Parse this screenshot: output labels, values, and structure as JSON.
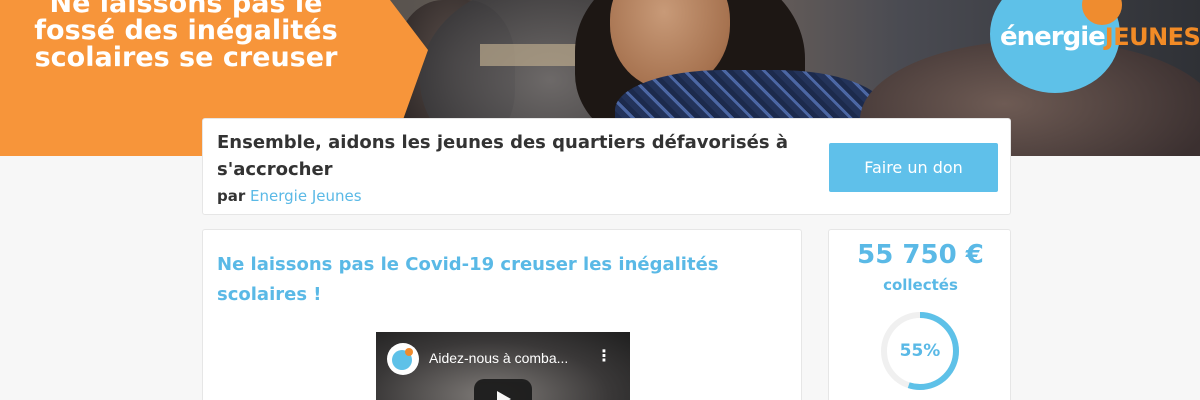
{
  "hero": {
    "headline": "Ne laissons pas le fossé des inégalités scolaires se creuser",
    "logo": {
      "part1": "énergie",
      "part2": "JEUNES"
    }
  },
  "campaign": {
    "title": "Ensemble, aidons les jeunes des quartiers défavorisés à s'accrocher",
    "by_label": "par",
    "organization": "Energie Jeunes",
    "donate_label": "Faire un don"
  },
  "main": {
    "title": "Ne laissons pas le Covid-19 creuser les inégalités scolaires !",
    "video": {
      "title": "Aidez-nous à comba...",
      "menu_glyph": "⋮"
    }
  },
  "stats": {
    "amount": "55 750 €",
    "collected_label": "collectés",
    "progress_fraction": 0.55,
    "progress_label": "55%"
  },
  "colors": {
    "accent": "#5ec1e8",
    "orange": "#f7953a",
    "text_dark": "#333333"
  }
}
